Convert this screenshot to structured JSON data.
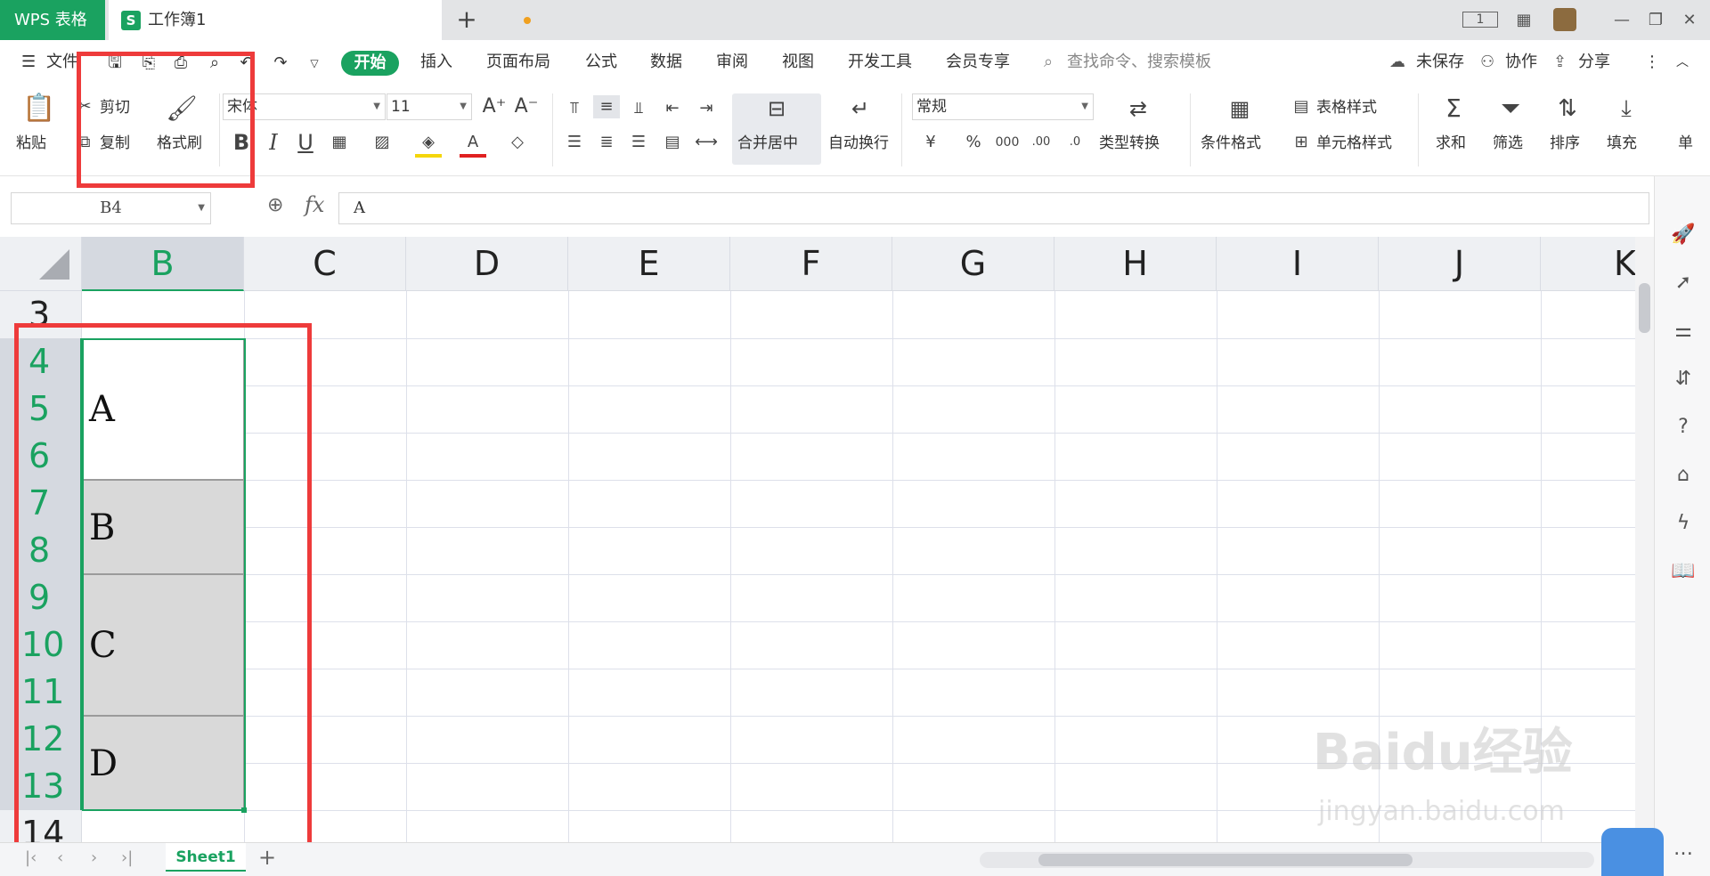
{
  "titlebar": {
    "app_name": "WPS 表格",
    "doc_name": "工作簿1",
    "doc_icon_letter": "S",
    "new_tab": "+",
    "page_indicator": "1"
  },
  "menu": {
    "file": "文件",
    "items": [
      "开始",
      "插入",
      "页面布局",
      "公式",
      "数据",
      "审阅",
      "视图",
      "开发工具",
      "会员专享"
    ],
    "search_placeholder": "查找命令、搜索模板",
    "unsaved": "未保存",
    "collab": "协作",
    "share": "分享"
  },
  "ribbon": {
    "paste": "粘贴",
    "cut": "剪切",
    "copy": "复制",
    "format_painter": "格式刷",
    "font_name": "宋体",
    "font_size": "11",
    "merge_center": "合并居中",
    "wrap_text": "自动换行",
    "number_format": "常规",
    "type_convert": "类型转换",
    "cond_format": "条件格式",
    "table_style": "表格样式",
    "cell_style": "单元格样式",
    "sum": "求和",
    "filter": "筛选",
    "sort": "排序",
    "fill": "填充",
    "cell_cut": "单"
  },
  "formula": {
    "cell_ref": "B4",
    "fx": "fx",
    "value": "A"
  },
  "grid": {
    "columns": [
      "B",
      "C",
      "D",
      "E",
      "F",
      "G",
      "H",
      "I",
      "J",
      "K"
    ],
    "rows": [
      "3",
      "4",
      "5",
      "6",
      "7",
      "8",
      "9",
      "10",
      "11",
      "12",
      "13",
      "14"
    ],
    "merged_cells": [
      {
        "text": "A",
        "rows": "4-6"
      },
      {
        "text": "B",
        "rows": "7-8"
      },
      {
        "text": "C",
        "rows": "9-11"
      },
      {
        "text": "D",
        "rows": "12-13"
      }
    ]
  },
  "sheets": {
    "active": "Sheet1",
    "add": "+"
  },
  "watermark": {
    "brand": "Baidu经验",
    "url": "jingyan.baidu.com"
  },
  "colors": {
    "accent": "#1aa260",
    "highlight": "#ee3b3b",
    "merged_gray": "#d9d9d9"
  }
}
